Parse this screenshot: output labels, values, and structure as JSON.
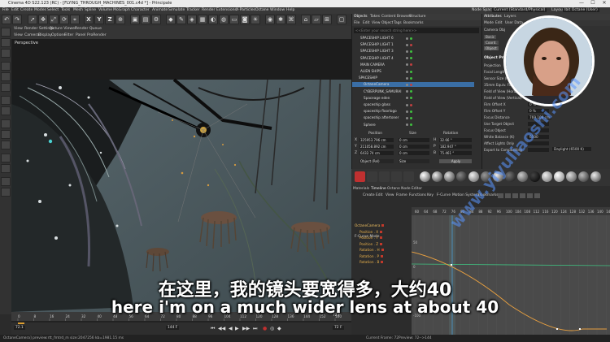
{
  "window": {
    "title": "Cinema 4D S22.123 (RC) - [FLYING_THROUGH_MACHINES_001.c4d *] - Principale",
    "minimize": "—",
    "maximize": "☐",
    "close": "✕"
  },
  "menu": [
    "File",
    "Edit",
    "Create",
    "Modes",
    "Select",
    "Tools",
    "Mesh",
    "Spline",
    "Volume",
    "MoGraph",
    "Character",
    "Animate",
    "Simulate",
    "Tracker",
    "Render",
    "Extensions",
    "X-Particles",
    "Octane",
    "Window",
    "Help"
  ],
  "menu_right": {
    "node_space_label": "Node Space:",
    "node_space_value": "Current (Standard/Physical)",
    "layout_label": "Layout:",
    "layout_value": "Ibit Octane (User)"
  },
  "toolbar": {
    "x": "X",
    "y": "Y",
    "z": "Z"
  },
  "viewport": {
    "top_tabs": [
      "View",
      "Render Settings",
      "Picture Viewer",
      "Render Queue"
    ],
    "menu": [
      "View",
      "Cameras",
      "Display",
      "Options",
      "Filter",
      "Panel",
      "ProRender"
    ],
    "label": "Perspective"
  },
  "subtitles": {
    "chinese": "在这里，我的镜头要宽得多，大约40",
    "english": "here i'm on a much wider lens at about 40"
  },
  "watermark": "www.yiyuliaoshi.com",
  "timeline": {
    "ticks": [
      "0",
      "8",
      "16",
      "24",
      "32",
      "40",
      "48",
      "56",
      "64",
      "72",
      "80",
      "88",
      "96",
      "104",
      "112",
      "120",
      "128",
      "136",
      "144",
      "152",
      "160"
    ],
    "current_frame": "72 F",
    "start": "72.1",
    "end": "144 F",
    "end2": "144 F",
    "right_value": "72 F"
  },
  "status": {
    "left": "OctaneCamera] preview:rtt_fmtrd_m size:2047256 kb=1981.15 ms",
    "right_current": "Current Frame: 72",
    "right_preview": "Preview: 72-->144"
  },
  "objects_panel": {
    "tabs": [
      "Objects",
      "Takes",
      "Content Browser",
      "Structure"
    ],
    "menu": [
      "File",
      "Edit",
      "View",
      "Object",
      "Tags",
      "Bookmarks"
    ],
    "search_placeholder": "<<Enter your search string here>>",
    "rows": [
      "SPACESHIP LIGHT 6",
      "SPACESHIP LIGHT 1",
      "SPACESHIP LIGHT 3",
      "SPACESHIP LIGHT 4",
      "MAIN CAMERA",
      "ALIEN SHIPS",
      "SPACESHIP",
      "OctaneCamera",
      "CYBERPUNK_SAMURAI",
      "Spaceage eden",
      "spaceship glass",
      "spaceship floorlogo",
      "spaceship aftertoner",
      "Sphere"
    ]
  },
  "coordinates": {
    "headers": [
      "Position",
      "Size",
      "Rotation"
    ],
    "x": {
      "label": "X",
      "pos": "325953.796 cm",
      "size": "0 cm",
      "rot_label": "H",
      "rot": "32.66 °"
    },
    "y": {
      "label": "Y",
      "pos": "211058.892 cm",
      "size": "0 cm",
      "rot_label": "P",
      "rot": "182.947 °"
    },
    "z": {
      "label": "Z",
      "pos": "6432.74 cm",
      "size": "0 cm",
      "rot_label": "B",
      "rot": "75.461 °"
    },
    "mode": "Object (Rel)",
    "size_mode": "Size",
    "apply": "Apply"
  },
  "attributes": {
    "tabs": [
      "Attributes",
      "Layers"
    ],
    "menu": [
      "Mode",
      "Edit",
      "User Data"
    ],
    "object_label": "Camera Obj",
    "subtabs": [
      "Basic",
      "Coord.",
      "Object",
      "Details"
    ],
    "section": "Object Properties",
    "rows": [
      {
        "label": "Projection",
        "value": ""
      },
      {
        "label": "Focal Length",
        "value": ""
      },
      {
        "label": "Sensor Size (Film Gate)",
        "value": ""
      },
      {
        "label": "35mm Equiv. Focal Length",
        "value": ""
      },
      {
        "label": "Field of View (Horizontal)",
        "value": ""
      },
      {
        "label": "Field of View (Vertical)",
        "value": ""
      },
      {
        "label": "Film Offset X",
        "value": "0 %"
      },
      {
        "label": "Film Offset Y",
        "value": "0 %"
      },
      {
        "label": "Focus Distance",
        "value": "769.108 cm"
      },
      {
        "label": "Use Target Object",
        "value": ""
      },
      {
        "label": "Focus Object",
        "value": ""
      },
      {
        "label": "White Balance (K)",
        "value": "6500"
      },
      {
        "label": "Affect Lights Only",
        "value": ""
      },
      {
        "label": "Export to Compositing",
        "value": ""
      }
    ],
    "wb_preset": "Daylight (6500 K)"
  },
  "graph_panel": {
    "tabs": [
      "Materials",
      "Timeline",
      "Octane Node Editor"
    ],
    "menu": [
      "Create",
      "Edit",
      "View",
      "Frame",
      "Functions",
      "Key",
      "F-Curve",
      "Motion System",
      "Bookmarks"
    ],
    "mode_label": "F-Curve Mode",
    "tracks": [
      "OctaneCamera",
      "Position . X",
      "Position . Y",
      "Position . Z",
      "Rotation . H",
      "Rotation . P",
      "Rotation . B"
    ],
    "ticks": [
      "60",
      "64",
      "68",
      "72",
      "76",
      "80",
      "84",
      "88",
      "92",
      "96",
      "100",
      "104",
      "108",
      "112",
      "116",
      "120",
      "124",
      "128",
      "132",
      "136",
      "140",
      "144"
    ],
    "yticks": [
      "50",
      "0",
      "-50",
      "-100"
    ]
  },
  "colors": {
    "accent": "#e8b04a",
    "selection": "#3a6ea5",
    "curve_orange": "#e8a040",
    "curve_green": "#40c080"
  },
  "icons": {
    "webcam": "presenter-webcam"
  }
}
